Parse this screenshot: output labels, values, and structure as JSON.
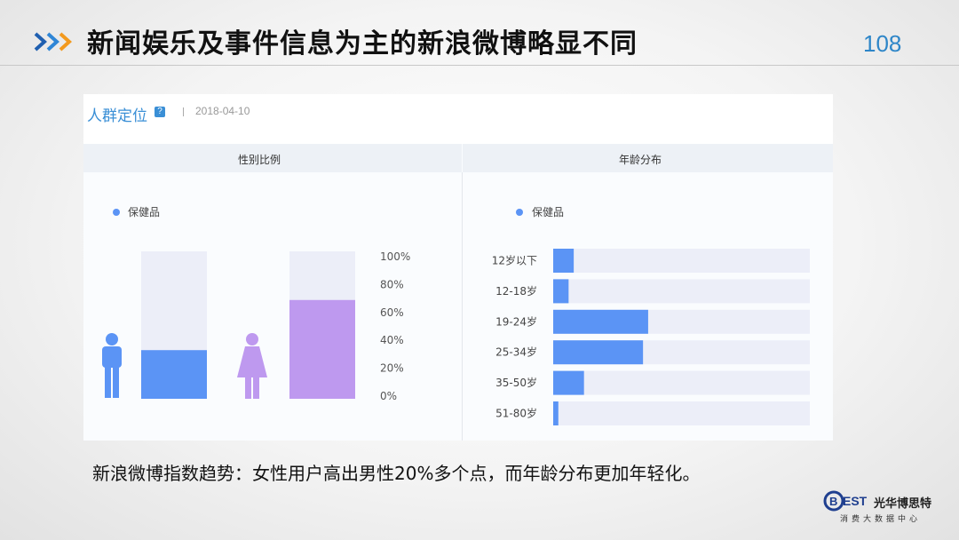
{
  "header": {
    "title": "新闻娱乐及事件信息为主的新浪微博略显不同",
    "page_number": "108"
  },
  "panel": {
    "title": "人群定位",
    "help_icon": "question-icon",
    "date": "2018-04-10",
    "gender_section": "性别比例",
    "age_section": "年龄分布"
  },
  "chart_data": [
    {
      "type": "bar",
      "title": "性别比例",
      "legend": [
        "保健品"
      ],
      "categories": [
        "男",
        "女"
      ],
      "series": [
        {
          "name": "保健品",
          "values": [
            33,
            67
          ]
        }
      ],
      "ylim": [
        0,
        100
      ],
      "y_ticks": [
        "100%",
        "80%",
        "60%",
        "40%",
        "20%",
        "0%"
      ],
      "colors": {
        "male": "#5b94f5",
        "female": "#be99ef",
        "track": "#eceef8"
      }
    },
    {
      "type": "bar",
      "orientation": "horizontal",
      "title": "年龄分布",
      "legend": [
        "保健品"
      ],
      "categories": [
        "12岁以下",
        "12-18岁",
        "19-24岁",
        "25-34岁",
        "35-50岁",
        "51-80岁"
      ],
      "series": [
        {
          "name": "保健品",
          "values": [
            8,
            6,
            37,
            35,
            12,
            2
          ]
        }
      ],
      "xlim": [
        0,
        100
      ],
      "colors": {
        "bar": "#5b94f5",
        "track": "#eceef8"
      }
    }
  ],
  "caption": "新浪微博指数趋势：女性用户高出男性20%多个点，而年龄分布更加年轻化。",
  "brand": {
    "name": "光华博思特",
    "logo_text": "BEST",
    "subtitle": "消费大数据中心"
  }
}
